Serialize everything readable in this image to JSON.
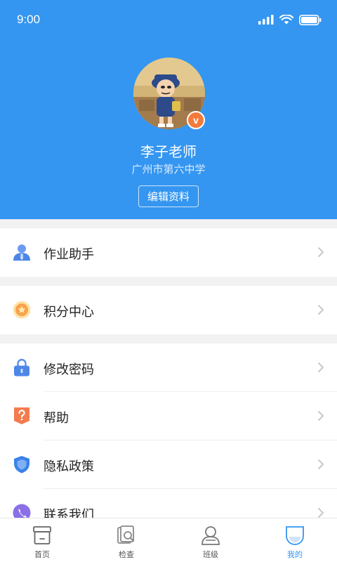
{
  "status": {
    "time": "9:00",
    "icons": [
      "signal-icon",
      "wifi-icon",
      "battery-icon"
    ]
  },
  "profile": {
    "name": "李子老师",
    "school": "广州市第六中学",
    "edit_label": "编辑资料",
    "badge_glyph": "v"
  },
  "menu": {
    "group1": [
      {
        "label": "作业助手",
        "icon": "user-icon"
      }
    ],
    "group2": [
      {
        "label": "积分中心",
        "icon": "coin-icon"
      }
    ],
    "group3": [
      {
        "label": "修改密码",
        "icon": "lock-icon"
      },
      {
        "label": "帮助",
        "icon": "help-icon"
      },
      {
        "label": "隐私政策",
        "icon": "shield-icon"
      },
      {
        "label": "联系我们",
        "icon": "phone-icon"
      }
    ]
  },
  "tabs": [
    {
      "label": "首页",
      "icon": "home-icon",
      "active": false
    },
    {
      "label": "检查",
      "icon": "check-icon",
      "active": false
    },
    {
      "label": "班级",
      "icon": "class-icon",
      "active": false
    },
    {
      "label": "我的",
      "icon": "profile-icon",
      "active": true
    }
  ],
  "colors": {
    "primary": "#3496f0",
    "accent_orange": "#f27a3b",
    "background": "#f2f2f2"
  }
}
